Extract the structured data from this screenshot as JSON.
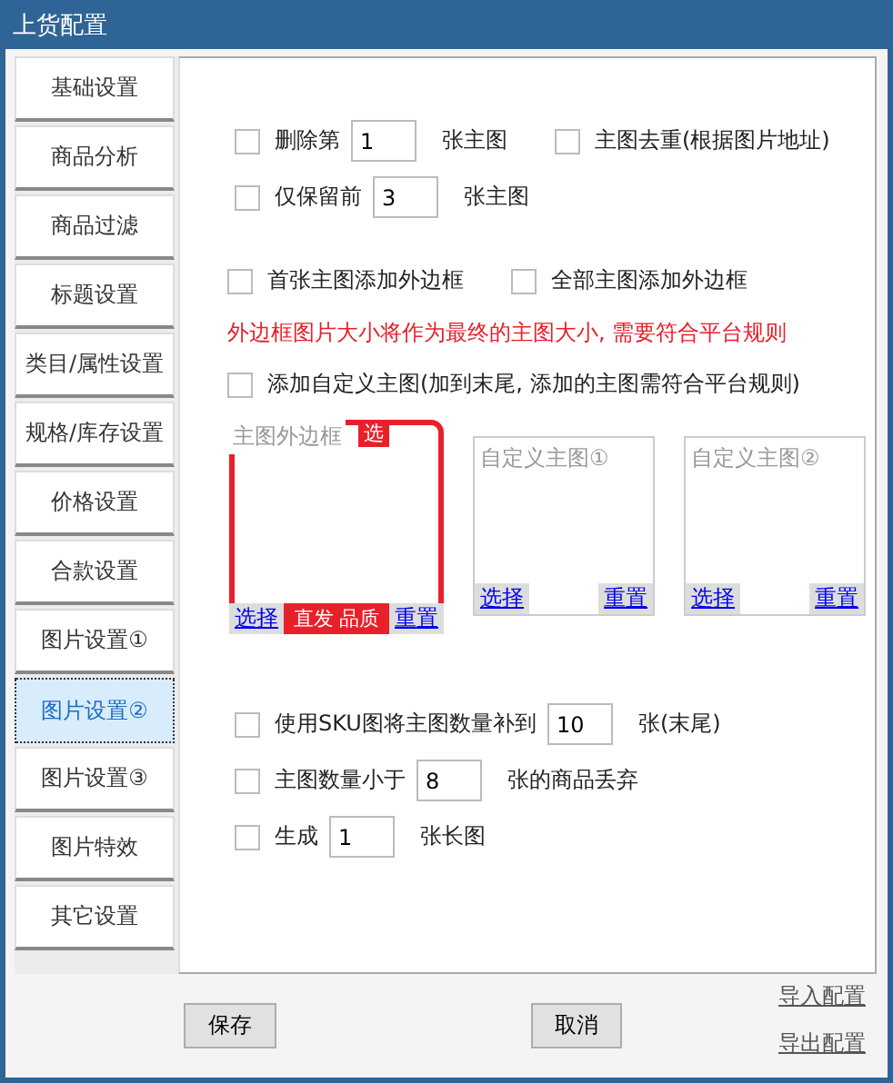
{
  "window": {
    "title": "上货配置"
  },
  "sidebar": {
    "items": [
      {
        "label": "基础设置",
        "selected": false
      },
      {
        "label": "商品分析",
        "selected": false
      },
      {
        "label": "商品过滤",
        "selected": false
      },
      {
        "label": "标题设置",
        "selected": false
      },
      {
        "label": "类目/属性设置",
        "selected": false
      },
      {
        "label": "规格/库存设置",
        "selected": false
      },
      {
        "label": "价格设置",
        "selected": false
      },
      {
        "label": "合款设置",
        "selected": false
      },
      {
        "label": "图片设置①",
        "selected": false
      },
      {
        "label": "图片设置②",
        "selected": true
      },
      {
        "label": "图片设置③",
        "selected": false
      },
      {
        "label": "图片特效",
        "selected": false
      },
      {
        "label": "其它设置",
        "selected": false
      }
    ]
  },
  "top_rows": [
    [
      {
        "kind": "number",
        "checked": false,
        "label": "删除第",
        "value": "1",
        "unit": "张主图"
      },
      {
        "kind": "check",
        "checked": false,
        "label": "主图去重(根据图片地址)"
      }
    ],
    [
      {
        "kind": "number",
        "checked": false,
        "label": "仅保留前",
        "value": "3",
        "unit": "张主图"
      }
    ]
  ],
  "border_options": [
    {
      "label": "首张主图添加外边框",
      "checked": false
    },
    {
      "label": "全部主图添加外边框",
      "checked": false
    }
  ],
  "warning": "外边框图片大小将作为最终的主图大小, 需要符合平台规则",
  "custom_option": {
    "label": "添加自定义主图(加到末尾, 添加的主图需符合平台规则)",
    "checked": false
  },
  "image_slots": [
    {
      "kind": "frame",
      "caption": "主图外边框",
      "tag": "选",
      "strip": "直发 品质",
      "select": "选择",
      "reset": "重置"
    },
    {
      "kind": "empty",
      "caption": "自定义主图①",
      "select": "选择",
      "reset": "重置"
    },
    {
      "kind": "empty",
      "caption": "自定义主图②",
      "select": "选择",
      "reset": "重置"
    }
  ],
  "bottom_rows": [
    {
      "kind": "number",
      "checked": false,
      "label": "使用SKU图将主图数量补到",
      "value": "10",
      "unit": "张(末尾)"
    },
    {
      "kind": "number",
      "checked": false,
      "label": "主图数量小于",
      "value": "8",
      "unit": "张的商品丢弃"
    },
    {
      "kind": "number",
      "checked": false,
      "label": "生成",
      "value": "1",
      "unit": "张长图"
    }
  ],
  "buttons": [
    {
      "label": "保存"
    },
    {
      "label": "取消"
    }
  ],
  "links": [
    "导入配置",
    "导出配置"
  ]
}
